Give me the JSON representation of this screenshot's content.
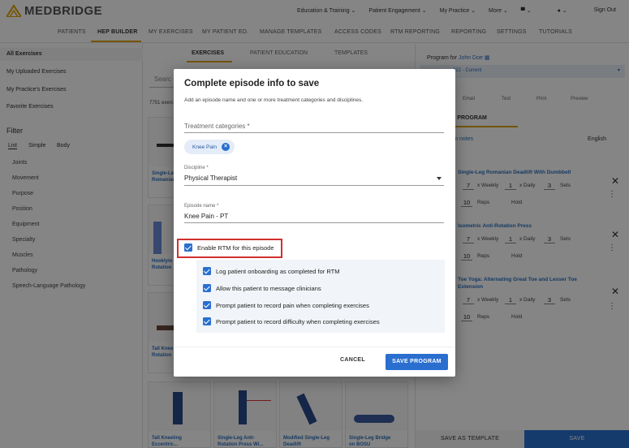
{
  "brand": {
    "name": "MEDBRIDGE",
    "accent": "#e0a200"
  },
  "top_nav": [
    "Education & Training ⌄",
    "Patient Engagement ⌄",
    "My Practice ⌄",
    "More ⌄",
    "⌄",
    "⌄"
  ],
  "sign_out": "Sign Out",
  "sub_nav": [
    "PATIENTS",
    "HEP BUILDER",
    "MY EXERCISES",
    "MY PATIENT ED.",
    "MANAGE TEMPLATES",
    "ACCESS CODES",
    "RTM REPORTING",
    "REPORTING",
    "SETTINGS",
    "TUTORIALS"
  ],
  "sidebar": {
    "items": [
      "All Exercises",
      "My Uploaded Exercises",
      "My Practice's Exercises",
      "Favorite Exercises"
    ],
    "filter_title": "Filter",
    "filter_tabs": [
      "List",
      "Simple",
      "Body"
    ],
    "categories": [
      "Joints",
      "Movement",
      "Purpose",
      "Position",
      "Equipment",
      "Specialty",
      "Muscles",
      "Pathology",
      "Speech-Language Pathology"
    ]
  },
  "center": {
    "tabs": [
      "EXERCISES",
      "PATIENT EDUCATION",
      "TEMPLATES"
    ],
    "search_placeholder": "Searc",
    "count": "7751 exerc",
    "cards": [
      "Single-Le",
      "Romanian",
      "Hooklyin",
      "Rotation",
      "Tall Knee",
      "Rotation",
      "Tall Kneeling",
      "Eccentric...",
      "Single-Leg Anti-",
      "Rotation Press Wi...",
      "Modified Single-Leg",
      "Deadlift",
      "Single-Leg Bridge",
      "on BOSU"
    ]
  },
  "right": {
    "program_for_label": "Program for",
    "patient_name": "John Doe",
    "program_select": "022 - Current",
    "actions": [
      "Email",
      "Text",
      "Print",
      "Preview"
    ],
    "section": "NT PROGRAM",
    "notes": "ram notes",
    "lang": "English",
    "s_char": "s",
    "exercises": [
      {
        "title_1": "Single-Leg Romanian Deadlift With Dumbbell",
        "title_2": "",
        "weekly": "7",
        "daily": "1",
        "sets": "3",
        "reps": "10"
      },
      {
        "title_1": "Isometric Anti-Rotation Press",
        "title_2": "",
        "weekly": "7",
        "daily": "1",
        "sets": "3",
        "reps": "10"
      },
      {
        "title_1": "Toe Yoga: Alternating Great Toe and Lesser Toe",
        "title_2": "Extension",
        "weekly": "7",
        "daily": "1",
        "sets": "3",
        "reps": "10"
      }
    ],
    "labels": {
      "weekly": "x Weekly",
      "daily": "x Daily",
      "sets": "Sets",
      "reps": "Reps",
      "hold": "Hold"
    },
    "save_template": "SAVE AS TEMPLATE",
    "save": "SAVE"
  },
  "modal": {
    "title": "Complete episode info to save",
    "subtitle": "Add an episode name and one or more treatment categories and disciplines.",
    "treatment_placeholder": "Treatment categories *",
    "chip": "Knee Pain",
    "discipline_label": "Discipline *",
    "discipline_value": "Physical Therapist",
    "episode_label": "Episode name *",
    "episode_value": "Knee Pain - PT",
    "rtm_label": "Enable RTM for this episode",
    "rtm_options": [
      "Log patient onboarding as completed for RTM",
      "Allow this patient to message clinicians",
      "Prompt patient to record pain when completing exercises",
      "Prompt patient to record difficulty when completing exercises"
    ],
    "cancel": "CANCEL",
    "save_program": "SAVE PROGRAM"
  }
}
